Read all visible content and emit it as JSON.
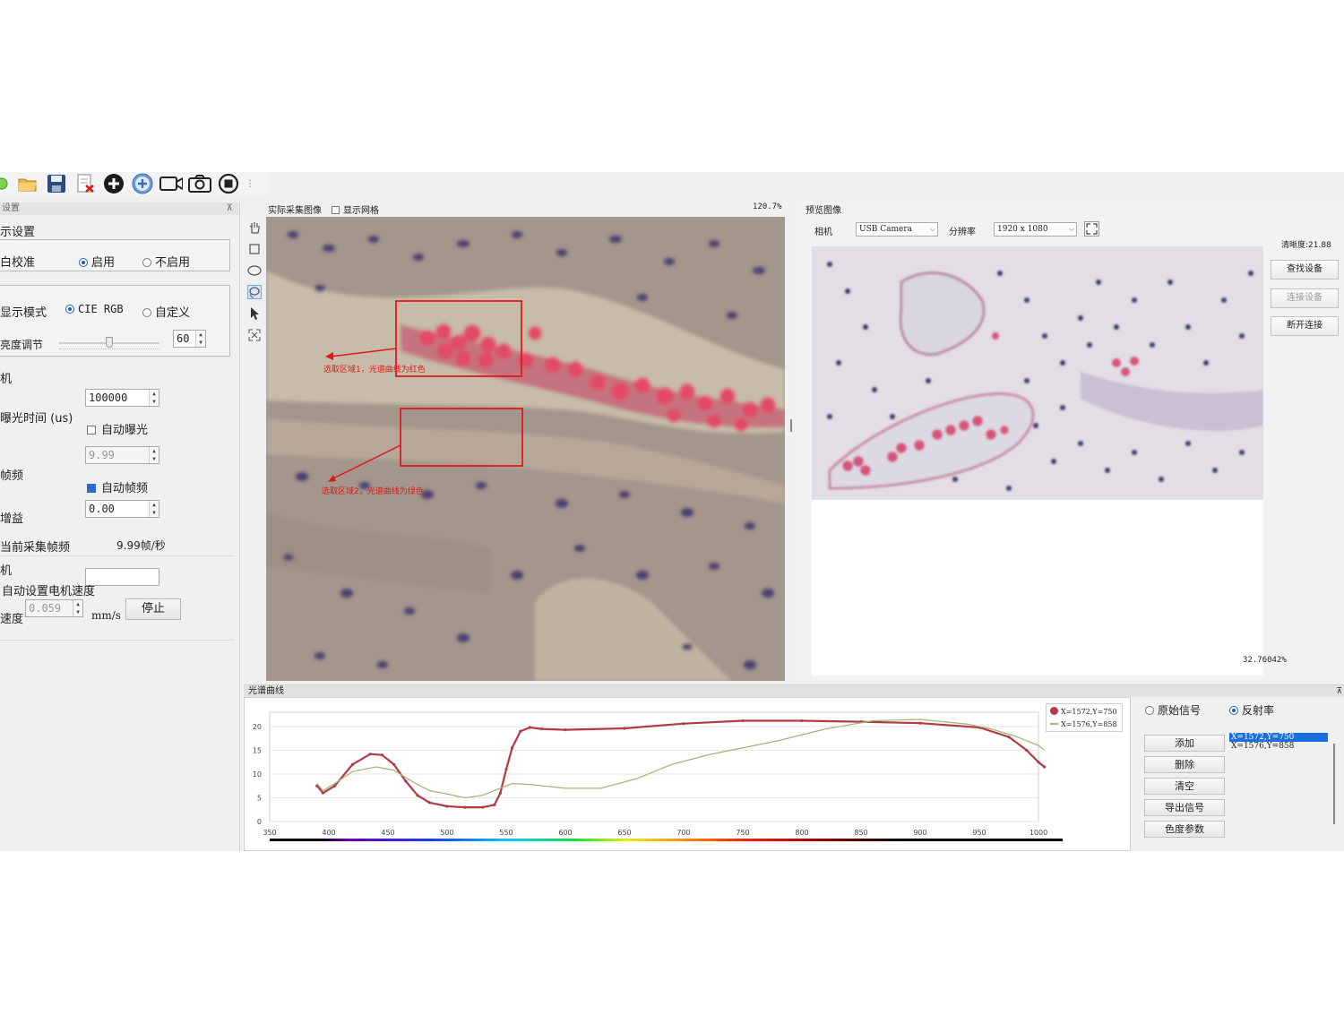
{
  "toolbar": {
    "icons": [
      "new-icon",
      "open-folder-icon",
      "save-icon",
      "delete-file-icon",
      "add-icon",
      "zoom-in-icon",
      "video-camera-icon",
      "camera-icon",
      "stop-icon"
    ]
  },
  "left": {
    "panel_title": "设置",
    "display_settings": "示设置",
    "white_balance": {
      "label": "白校准",
      "opt_on": "启用",
      "opt_off": "不启用"
    },
    "display_mode": {
      "label": "显示模式",
      "opt_cie": "CIE RGB",
      "opt_custom": "自定义"
    },
    "brightness": {
      "label": "亮度调节",
      "value": "60",
      "level": 0.5
    },
    "camera_section": "机",
    "exposure": {
      "label": "曝光时间 (us)",
      "value": "100000",
      "auto_label": "自动曝光"
    },
    "framerate": {
      "label": "帧频",
      "value": "9.99",
      "auto_label": "自动帧频"
    },
    "gain": {
      "label": "增益",
      "value": "0.00"
    },
    "current_fps": {
      "label": "当前采集帧频",
      "value": "9.99帧/秒"
    },
    "motor_section": "机",
    "motor_auto": "自动设置电机速度",
    "speed": {
      "label": "速度",
      "value": "0.059",
      "unit": "mm/s",
      "button": "停止"
    }
  },
  "center": {
    "title": "实际采集图像",
    "grid_label": "显示网格",
    "zoom": "120.7%",
    "annotation1": "选取区域1，光谱曲线为红色",
    "annotation2": "选取区域2，光谱曲线为绿色"
  },
  "right": {
    "title": "预览图像",
    "camera_label": "相机",
    "camera_value": "USB Camera",
    "resolution_label": "分辨率",
    "resolution_value": "1920 x 1080",
    "sharpness": "清晰度:21.88",
    "btn_find": "查找设备",
    "btn_connect": "连接设备",
    "btn_disconnect": "断开连接",
    "zoom": "32.76042%"
  },
  "spectrum": {
    "title": "光谱曲线",
    "mode_raw": "原始信号",
    "mode_reflect": "反射率",
    "btn_add": "添加",
    "btn_delete": "删除",
    "btn_clear": "清空",
    "btn_export": "导出信号",
    "btn_color": "色度参数",
    "list": [
      "X=1572,Y=750",
      "X=1576,Y=858"
    ]
  },
  "chart_data": {
    "type": "line",
    "xlim": [
      350,
      1000
    ],
    "ylim": [
      0,
      23
    ],
    "xticks": [
      350,
      400,
      450,
      500,
      550,
      600,
      650,
      700,
      750,
      800,
      850,
      900,
      950,
      1000
    ],
    "yticks": [
      0,
      5,
      10,
      15,
      20
    ],
    "legend_position": "top-right",
    "grid": true,
    "series": [
      {
        "name": "X=1572,Y=750",
        "color": "#b23a45",
        "x": [
          390,
          395,
          405,
          420,
          435,
          445,
          455,
          465,
          475,
          485,
          500,
          515,
          530,
          540,
          545,
          550,
          555,
          562,
          570,
          580,
          600,
          650,
          700,
          750,
          800,
          850,
          900,
          950,
          975,
          990,
          1000,
          1005
        ],
        "y": [
          7.5,
          6.0,
          7.5,
          12.0,
          14.2,
          14.0,
          12.0,
          8.5,
          5.5,
          4.0,
          3.2,
          3.0,
          3.0,
          3.5,
          6.0,
          11.0,
          15.5,
          19.0,
          19.8,
          19.5,
          19.3,
          19.6,
          20.6,
          21.2,
          21.2,
          21.0,
          20.7,
          19.8,
          17.8,
          15.0,
          12.5,
          11.5
        ]
      },
      {
        "name": "X=1576,Y=858",
        "color": "#a9b37a",
        "x": [
          390,
          395,
          405,
          420,
          440,
          455,
          470,
          485,
          500,
          515,
          530,
          545,
          555,
          570,
          600,
          630,
          660,
          690,
          720,
          740,
          750,
          760,
          780,
          820,
          860,
          900,
          940,
          960,
          980,
          1000,
          1005
        ],
        "y": [
          8.0,
          6.5,
          8.0,
          10.5,
          11.5,
          10.8,
          8.5,
          6.5,
          5.8,
          5.0,
          5.5,
          7.0,
          8.0,
          7.8,
          7.0,
          7.0,
          9.0,
          12.0,
          14.0,
          15.0,
          15.5,
          16.0,
          17.0,
          19.5,
          21.2,
          21.5,
          20.5,
          19.5,
          18.0,
          16.0,
          15.0
        ]
      }
    ]
  }
}
